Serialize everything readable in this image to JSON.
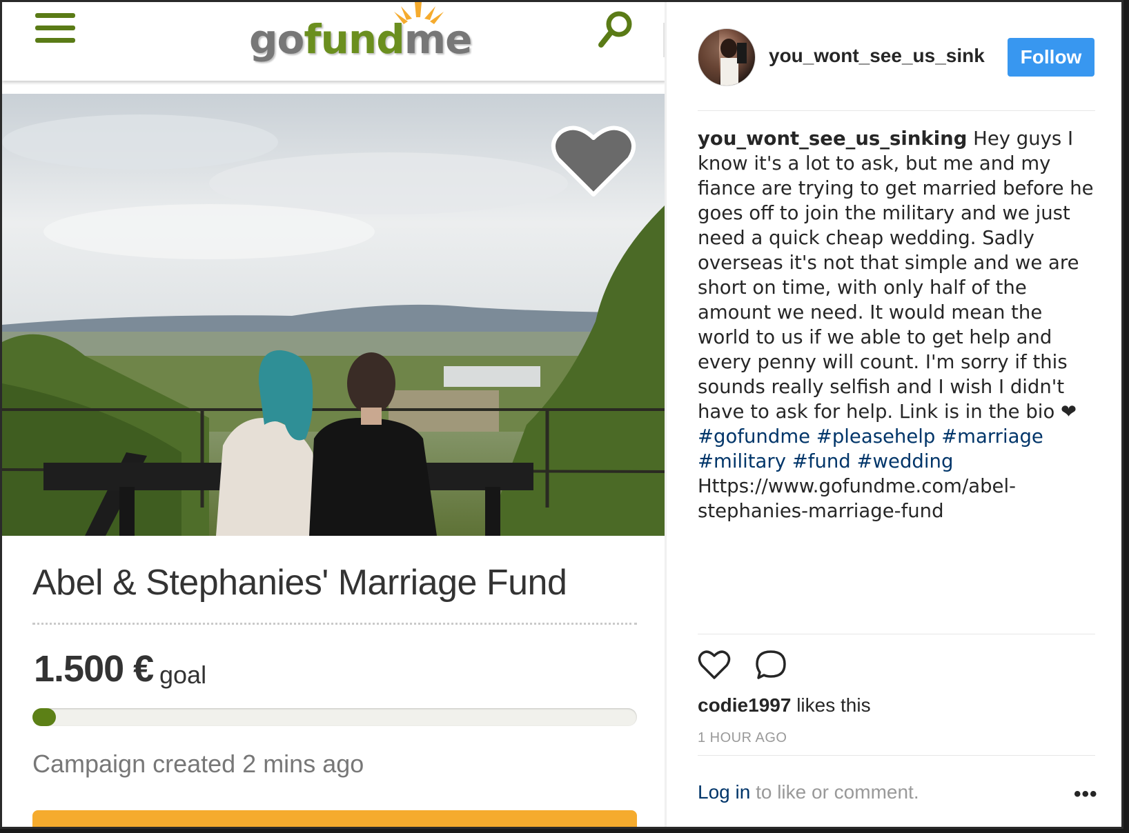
{
  "gofundme": {
    "logo": {
      "go": "go",
      "fund": "fund",
      "me": "me"
    },
    "campaign_title": "Abel & Stephanies' Marriage Fund",
    "goal_amount": "1.500 €",
    "goal_word": "goal",
    "progress_fraction": 0.02,
    "created": "Campaign created 2 mins ago",
    "colors": {
      "brand_green": "#5c8016",
      "donate_orange": "#f5ab2e"
    }
  },
  "instagram": {
    "username": "you_wont_see_us_sink",
    "follow_label": "Follow",
    "caption_user": "you_wont_see_us_sinking",
    "caption_text": "Hey guys I know it's a lot to ask, but me and my fiance are trying to get married before he goes off to join the military and we just need a quick cheap wedding. Sadly overseas it's not that simple and we are short on time, with only half of the amount we need. It would mean the world to us if we able to get help and every penny will count. I'm sorry if this sounds really selfish and I wish I didn't have to ask for help. Link is in the bio",
    "caption_heart": "❤",
    "hashtags": [
      "#gofundme",
      "#pleasehelp",
      "#marriage",
      "#military",
      "#fund",
      "#wedding"
    ],
    "caption_link": "Https://www.gofundme.com/abel-stephanies-marriage-fund",
    "liker": "codie1997",
    "likes_suffix": "likes this",
    "timestamp": "1 HOUR AGO",
    "login_link": "Log in",
    "login_suffix": "to like or comment.",
    "more": "•••",
    "colors": {
      "follow_blue": "#3897f0",
      "hashtag_blue": "#003569"
    }
  },
  "icons": [
    "hamburger-menu-icon",
    "search-icon",
    "favorite-heart-icon",
    "like-heart-icon",
    "comment-bubble-icon"
  ]
}
